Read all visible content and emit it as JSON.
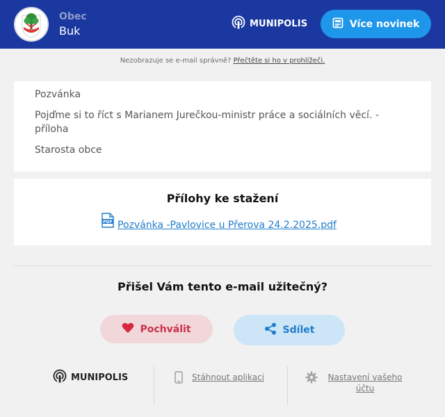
{
  "header": {
    "org_label": "Obec",
    "org_name": "Buk",
    "brand": "MUNIPOLIS",
    "more_news_label": "Více novinek",
    "colors": {
      "background": "#1a38a0",
      "button": "#1e96ea"
    }
  },
  "notice": {
    "text": "Nezobrazuje se e-mail správně?",
    "link": "Přečtěte si ho v prohlížeči."
  },
  "message": {
    "lines": [
      "Pozvánka",
      "Pojďme si to říct s Marianem Jurečkou-ministr práce a sociálních věcí. - příloha",
      "Starosta obce"
    ]
  },
  "attachments": {
    "title": "Přílohy ke stažení",
    "files": [
      {
        "name": "Pozvánka -Pavlovice u Přerova 24.2.2025.pdf",
        "icon": "pdf-icon"
      }
    ]
  },
  "feedback": {
    "question": "Přišel Vám tento e-mail užitečný?",
    "praise_label": "Pochválit",
    "share_label": "Sdílet"
  },
  "footer": {
    "brand": "MUNIPOLIS",
    "download_app": "Stáhnout aplikaci",
    "account_settings": "Nastavení vašeho účtu"
  }
}
